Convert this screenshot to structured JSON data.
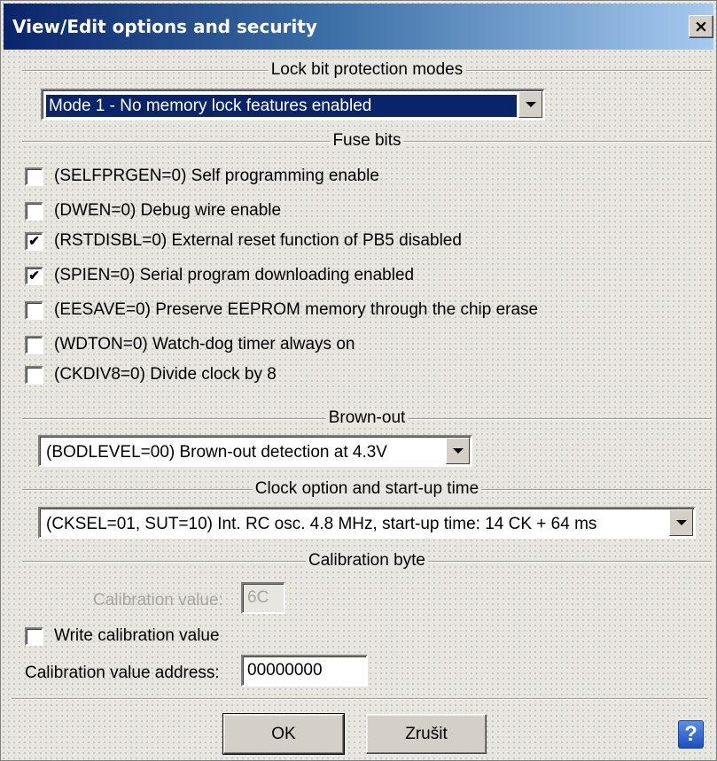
{
  "window": {
    "title": "View/Edit options and security",
    "close_glyph": "×"
  },
  "lock_bits": {
    "heading": "Lock bit protection modes",
    "selected": "Mode 1 - No memory lock features enabled"
  },
  "fuse_bits": {
    "heading": "Fuse bits",
    "items": [
      {
        "label": "(SELFPRGEN=0) Self programming enable",
        "checked": false
      },
      {
        "label": "(DWEN=0) Debug wire enable",
        "checked": false
      },
      {
        "label": "(RSTDISBL=0) External reset function of PB5 disabled",
        "checked": true
      },
      {
        "label": "(SPIEN=0) Serial program downloading enabled",
        "checked": true
      },
      {
        "label": "(EESAVE=0) Preserve EEPROM memory through the chip erase",
        "checked": false
      },
      {
        "label": "(WDTON=0) Watch-dog timer always on",
        "checked": false
      },
      {
        "label": "(CKDIV8=0) Divide clock by 8",
        "checked": false
      }
    ]
  },
  "brown_out": {
    "heading": "Brown-out",
    "selected": "(BODLEVEL=00) Brown-out detection at 4.3V"
  },
  "clock": {
    "heading": "Clock option and start-up time",
    "selected": "(CKSEL=01, SUT=10) Int. RC osc. 4.8 MHz, start-up time: 14 CK + 64 ms"
  },
  "calibration": {
    "heading": "Calibration byte",
    "value_label": "Calibration value:",
    "value": "6C",
    "write_label": "Write calibration value",
    "write_checked": false,
    "address_label": "Calibration value address:",
    "address": "00000000"
  },
  "buttons": {
    "ok": "OK",
    "cancel": "Zrušit",
    "help_glyph": "?"
  },
  "colors": {
    "title_start": "#0a246a",
    "title_end": "#a6caf0",
    "selection": "#0a246a"
  },
  "icons": {
    "help": "help-icon",
    "dropdown": "chevron-down-icon",
    "check": "check-icon",
    "close": "close-icon"
  }
}
